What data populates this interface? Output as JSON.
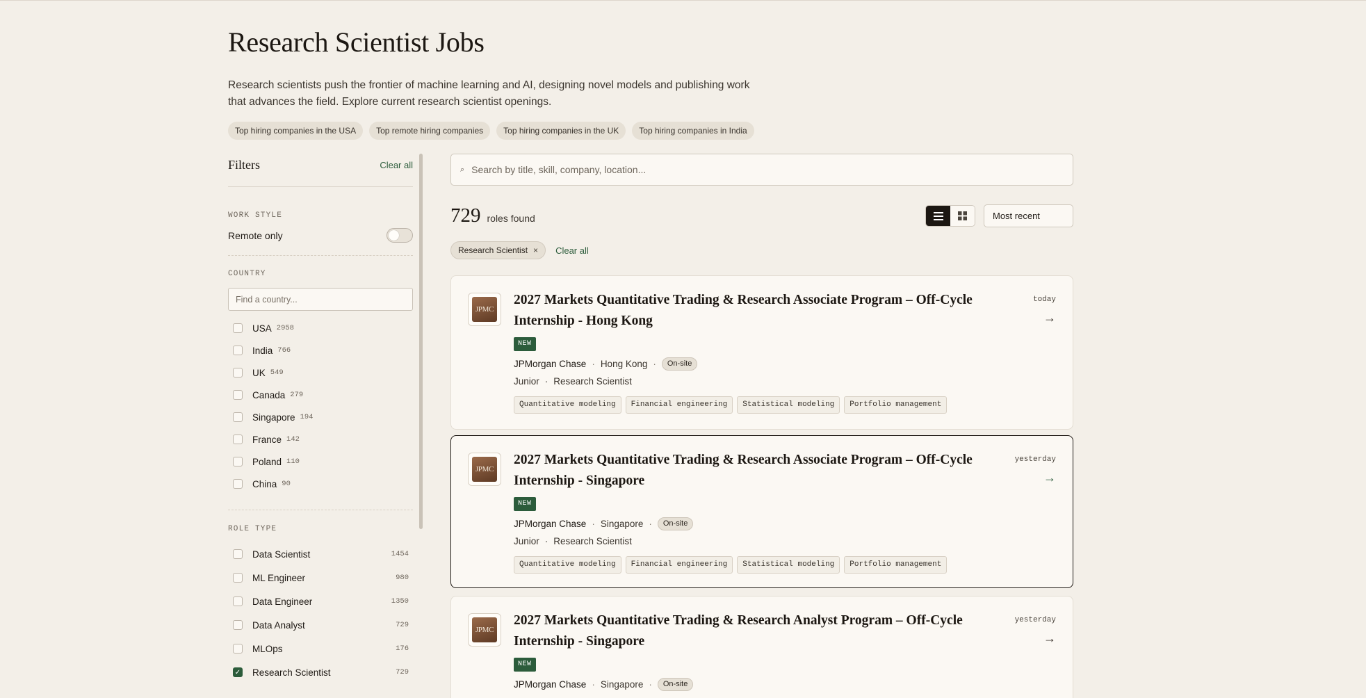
{
  "page": {
    "title": "Research Scientist Jobs",
    "intro": "Research scientists push the frontier of machine learning and AI, designing novel models and publishing work that advances the field. Explore current research scientist openings.",
    "chips": [
      "Top hiring companies in the USA",
      "Top remote hiring companies",
      "Top hiring companies in the UK",
      "Top hiring companies in India"
    ]
  },
  "filters": {
    "title": "Filters",
    "clear_all": "Clear all",
    "work_style": {
      "label": "WORK STYLE",
      "remote_only": "Remote only",
      "remote_on": false
    },
    "country": {
      "label": "COUNTRY",
      "placeholder": "Find a country...",
      "items": [
        {
          "name": "USA",
          "count": "2958"
        },
        {
          "name": "India",
          "count": "766"
        },
        {
          "name": "UK",
          "count": "549"
        },
        {
          "name": "Canada",
          "count": "279"
        },
        {
          "name": "Singapore",
          "count": "194"
        },
        {
          "name": "France",
          "count": "142"
        },
        {
          "name": "Poland",
          "count": "110"
        },
        {
          "name": "China",
          "count": "90"
        }
      ]
    },
    "role_type": {
      "label": "ROLE TYPE",
      "items": [
        {
          "name": "Data Scientist",
          "count": "1454",
          "checked": false
        },
        {
          "name": "ML Engineer",
          "count": "980",
          "checked": false
        },
        {
          "name": "Data Engineer",
          "count": "1350",
          "checked": false
        },
        {
          "name": "Data Analyst",
          "count": "729",
          "checked": false
        },
        {
          "name": "MLOps",
          "count": "176",
          "checked": false
        },
        {
          "name": "Research Scientist",
          "count": "729",
          "checked": true
        }
      ]
    }
  },
  "search": {
    "placeholder": "Search by title, skill, company, location...",
    "icon": "search-icon"
  },
  "results": {
    "count": "729",
    "label": "roles found",
    "sort": "Most recent",
    "view_mode": "list",
    "active_filter": "Research Scientist",
    "clear_all": "Clear all"
  },
  "jobs": [
    {
      "logo": "JPMC",
      "title": "2027 Markets Quantitative Trading & Research Associate Program – Off-Cycle Internship - Hong Kong",
      "date": "today",
      "badge": "NEW",
      "company": "JPMorgan Chase",
      "location": "Hong Kong",
      "work_mode": "On-site",
      "level": "Junior",
      "role": "Research Scientist",
      "tags": [
        "Quantitative modeling",
        "Financial engineering",
        "Statistical modeling",
        "Portfolio management"
      ]
    },
    {
      "logo": "JPMC",
      "title": "2027 Markets Quantitative Trading & Research Associate Program – Off-Cycle Internship - Singapore",
      "date": "yesterday",
      "badge": "NEW",
      "company": "JPMorgan Chase",
      "location": "Singapore",
      "work_mode": "On-site",
      "level": "Junior",
      "role": "Research Scientist",
      "tags": [
        "Quantitative modeling",
        "Financial engineering",
        "Statistical modeling",
        "Portfolio management"
      ]
    },
    {
      "logo": "JPMC",
      "title": "2027 Markets Quantitative Trading & Research Analyst Program – Off-Cycle Internship - Singapore",
      "date": "yesterday",
      "badge": "NEW",
      "company": "JPMorgan Chase",
      "location": "Singapore",
      "work_mode": "On-site"
    }
  ],
  "colors": {
    "background": "#f3efe8",
    "accent_green": "#2c5c3b",
    "dark": "#1c1712"
  }
}
